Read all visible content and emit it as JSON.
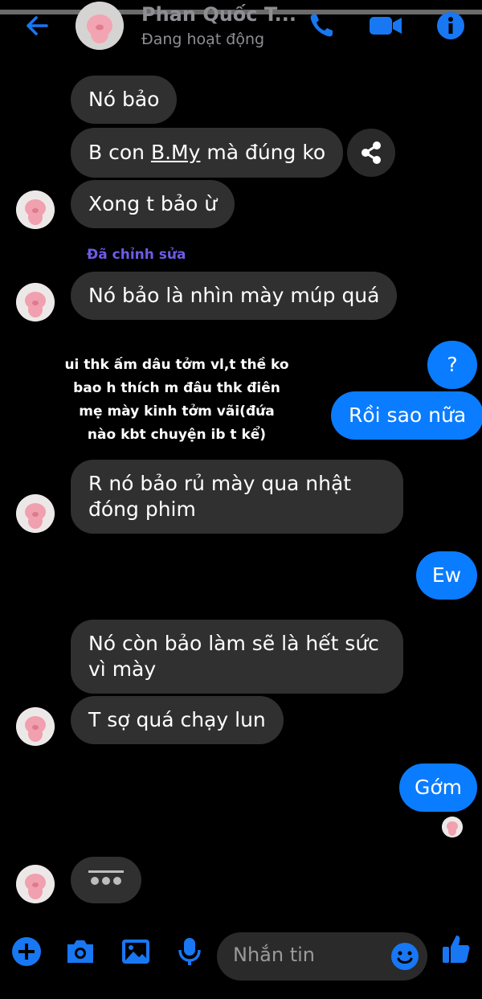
{
  "header": {
    "title": "Phan Quốc T...",
    "status": "Đang hoạt động",
    "icons": {
      "back": "back-arrow-icon",
      "call": "phone-icon",
      "video": "video-camera-icon",
      "info": "info-icon"
    },
    "accent": "#1877f2"
  },
  "messages": {
    "m1": "Nó bảo",
    "m2_a": "B con ",
    "m2_link": "B.My",
    "m2_b": " mà đúng ko",
    "m3": "Xong t bảo ừ",
    "edited_label": "Đã chỉnh sửa",
    "m4": "Nó bảo là nhìn mày múp quá",
    "me1": "?",
    "me2": "Rồi sao nữa",
    "m5": "R nó bảo rủ mày qua nhật đóng phim",
    "me3": "Ew",
    "m6": "Nó còn bảo làm sẽ là hết sức vì mày",
    "m7": "T sợ quá chạy lun",
    "me4": "Gớm"
  },
  "overlay_text": {
    "line1": "ui thk ấm dâu tởm vl,t thề ko",
    "line2": "bao h thích m đâu thk điên",
    "line3": "mẹ mày kinh tởm vãi(đứa",
    "line4": "nào kbt chuyện ib t kể)"
  },
  "composer": {
    "placeholder": "Nhắn tin",
    "icons": [
      "plus-icon",
      "camera-icon",
      "image-icon",
      "microphone-icon",
      "emoji-icon",
      "thumbs-up-icon"
    ]
  },
  "colors": {
    "background": "#000000",
    "bubble_them": "#303030",
    "bubble_me": "#0a7cff",
    "edited": "#6c5ce7"
  }
}
